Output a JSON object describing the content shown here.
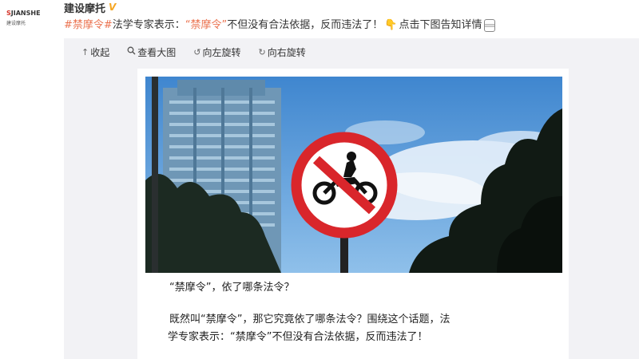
{
  "account": {
    "logo_text_s": "S",
    "logo_text_main": "JIANSHE",
    "logo_sub": "建设摩托",
    "name": "建设摩托",
    "verified": "V"
  },
  "post": {
    "hashtag": "#禁摩令#",
    "text_a": "法学专家表示：",
    "quoted": "“禁摩令”",
    "text_b": "不但没有合法依据，反而违法了！",
    "text_c": "点击下图告知详情"
  },
  "toolbar": {
    "collapse": "收起",
    "view_large": "查看大图",
    "rotate_left": "向左旋转",
    "rotate_right": "向右旋转"
  },
  "article": {
    "p1": "“禁摩令”，依了哪条法令？",
    "p2_line1": "既然叫“禁摩令”，那它究竟依了哪条法令？围绕这个话题，法",
    "p2_line2": "学专家表示：“禁摩令”不但没有合法依据，反而违法了！"
  },
  "colors": {
    "link": "#eb7350",
    "sign_red": "#d9262b",
    "sky": "#5b9ad6"
  }
}
